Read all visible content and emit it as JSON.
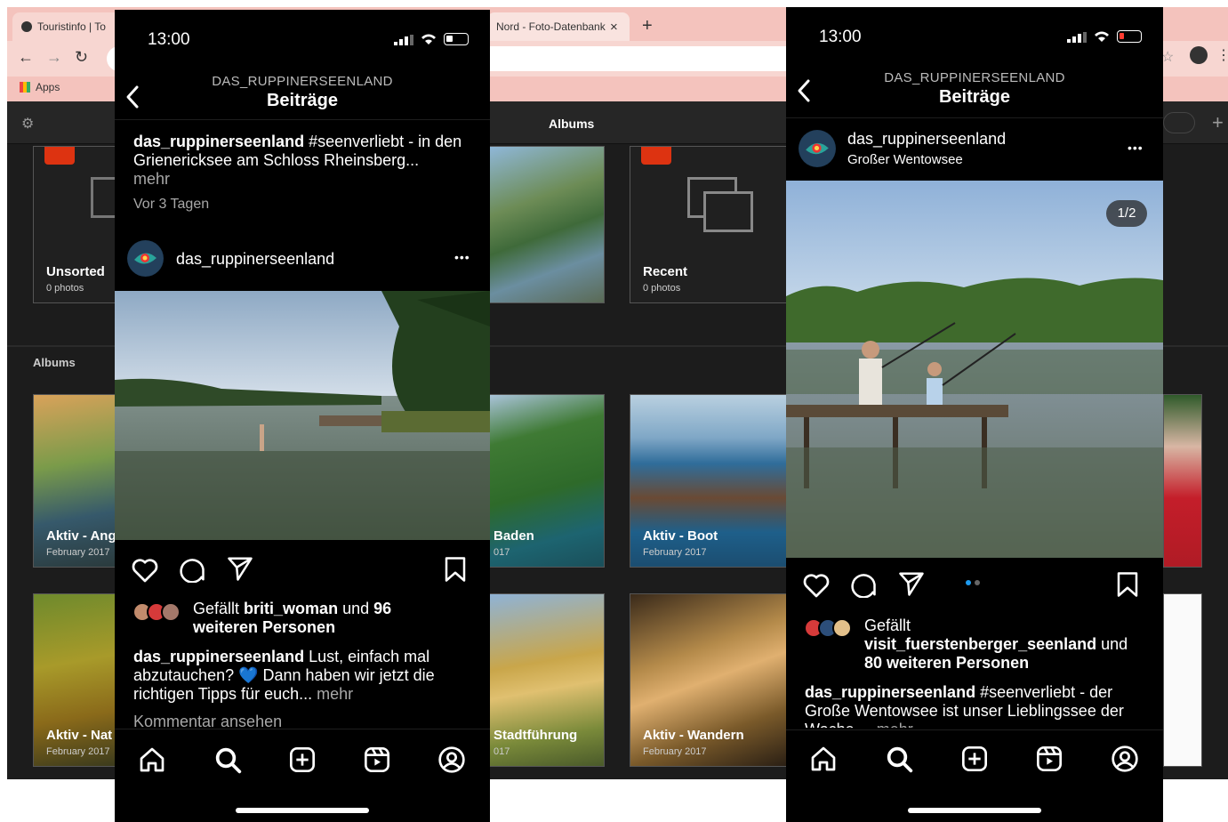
{
  "browser": {
    "tabs": [
      {
        "title": "Touristinfo | To"
      },
      {
        "title": "Nord - Foto-Datenbank"
      }
    ],
    "tab_close": "×",
    "new_tab": "+",
    "bookmarks_label": "Apps",
    "app_header_title": "Albums",
    "albums_top": [
      {
        "name": "Unsorted",
        "count": "0 photos"
      },
      {
        "name": "Recent",
        "count": "0 photos"
      }
    ],
    "section_label": "Albums",
    "albums": [
      {
        "name": "Aktiv - Ang",
        "date": "February 2017"
      },
      {
        "name": "Baden",
        "date": "017"
      },
      {
        "name": "Aktiv - Boot",
        "date": "February 2017"
      },
      {
        "name": "Aktiv - Nat",
        "date": "February 2017"
      },
      {
        "name": "Stadtführung",
        "date": "017"
      },
      {
        "name": "Aktiv - Wandern",
        "date": "February 2017"
      }
    ]
  },
  "phone_left": {
    "time": "13:00",
    "account": "DAS_RUPPINERSEENLAND",
    "header": "Beiträge",
    "prev_caption": {
      "user": "das_ruppinerseenland",
      "text": "#seenverliebt - in den Grienericksee am Schloss Rheinsberg...",
      "more": "mehr",
      "time": "Vor 3 Tagen"
    },
    "post_user": "das_ruppinerseenland",
    "menu": "•••",
    "likes": {
      "prefix": "Gefällt",
      "user": "briti_woman",
      "mid": "und",
      "rest": "96 weiteren Personen"
    },
    "caption": {
      "user": "das_ruppinerseenland",
      "text": "Lust, einfach mal abzutauchen? 💙 Dann haben wir jetzt die richtigen Tipps für euch...",
      "more": "mehr"
    },
    "comments": "Kommentar ansehen"
  },
  "phone_right": {
    "time": "13:00",
    "account": "DAS_RUPPINERSEENLAND",
    "header": "Beiträge",
    "post_user": "das_ruppinerseenland",
    "location": "Großer Wentowsee",
    "menu": "•••",
    "counter": "1/2",
    "likes": {
      "prefix": "Gefällt",
      "user": "visit_fuerstenberger_seenland",
      "mid": "und",
      "rest": "80 weiteren Personen"
    },
    "caption": {
      "user": "das_ruppinerseenland",
      "text": "#seenverliebt - der Große Wentowsee ist unser Lieblingssee der Woche ...",
      "more": "mehr"
    }
  },
  "colors": {
    "chrome_tab": "#f4c3bd",
    "app_bg": "#1c1c1c",
    "phone_bg": "#000000",
    "story_blue": "#1d9bf0"
  }
}
